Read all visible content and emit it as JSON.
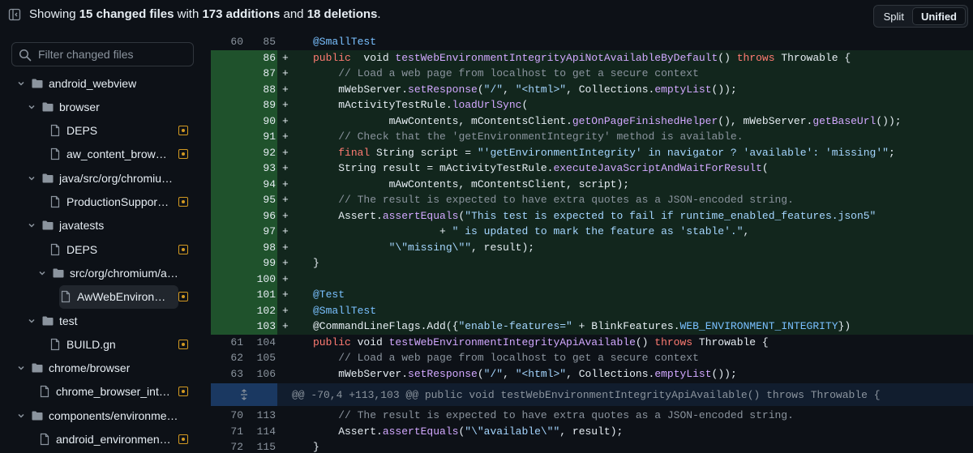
{
  "header": {
    "summary_prefix": "Showing ",
    "files_changed": "15 changed files",
    "summary_mid1": " with ",
    "additions": "173 additions",
    "summary_mid2": " and ",
    "deletions": "18 deletions",
    "summary_suffix": ".",
    "view_split": "Split",
    "view_unified": "Unified",
    "active_view": "Unified"
  },
  "sidebar": {
    "filter_placeholder": "Filter changed files",
    "items": [
      {
        "type": "folder",
        "label": "android_webview",
        "depth": 0
      },
      {
        "type": "folder",
        "label": "browser",
        "depth": 1
      },
      {
        "type": "file",
        "label": "DEPS",
        "depth": 2,
        "status": "modified"
      },
      {
        "type": "file",
        "label": "aw_content_browser…",
        "depth": 2,
        "status": "modified"
      },
      {
        "type": "folder",
        "label": "java/src/org/chromium/an…",
        "depth": 1
      },
      {
        "type": "file",
        "label": "ProductionSupporte…",
        "depth": 2,
        "status": "modified"
      },
      {
        "type": "folder",
        "label": "javatests",
        "depth": 1
      },
      {
        "type": "file",
        "label": "DEPS",
        "depth": 2,
        "status": "modified"
      },
      {
        "type": "folder",
        "label": "src/org/chromium/andro…",
        "depth": 2
      },
      {
        "type": "file",
        "label": "AwWebEnvironmen…",
        "depth": 3,
        "status": "modified",
        "selected": true
      },
      {
        "type": "folder",
        "label": "test",
        "depth": 1
      },
      {
        "type": "file",
        "label": "BUILD.gn",
        "depth": 2,
        "status": "modified"
      },
      {
        "type": "folder",
        "label": "chrome/browser",
        "depth": 0
      },
      {
        "type": "file",
        "label": "chrome_browser_inte…",
        "depth": 1,
        "status": "modified"
      },
      {
        "type": "folder",
        "label": "components/environment…",
        "depth": 0
      },
      {
        "type": "file",
        "label": "android_environment…",
        "depth": 1,
        "status": "modified"
      }
    ]
  },
  "diff": {
    "hunk_header": "@@ -70,4 +113,103 @@ public void testWebEnvironmentIntegrityApiAvailable() throws Throwable {",
    "lines": [
      {
        "kind": "ctx",
        "old": "60",
        "new": "85",
        "tokens": [
          [
            "a",
            "@SmallTest"
          ]
        ]
      },
      {
        "kind": "add",
        "old": "",
        "new": "86",
        "tokens": [
          [
            "k",
            "public"
          ],
          [
            "",
            "  void "
          ],
          [
            "f",
            "testWebEnvironmentIntegrityApiNotAvailableByDefault"
          ],
          [
            "",
            "() "
          ],
          [
            "k",
            "throws"
          ],
          [
            "",
            " Throwable {"
          ]
        ]
      },
      {
        "kind": "add",
        "old": "",
        "new": "87",
        "tokens": [
          [
            "",
            "    "
          ],
          [
            "c",
            "// Load a web page from localhost to get a secure context"
          ]
        ]
      },
      {
        "kind": "add",
        "old": "",
        "new": "88",
        "tokens": [
          [
            "",
            "    mWebServer."
          ],
          [
            "f",
            "setResponse"
          ],
          [
            "",
            "("
          ],
          [
            "s",
            "\"/\""
          ],
          [
            "",
            ", "
          ],
          [
            "s",
            "\"<html>\""
          ],
          [
            "",
            ", Collections."
          ],
          [
            "f",
            "emptyList"
          ],
          [
            "",
            "());"
          ]
        ]
      },
      {
        "kind": "add",
        "old": "",
        "new": "89",
        "tokens": [
          [
            "",
            "    mActivityTestRule."
          ],
          [
            "f",
            "loadUrlSync"
          ],
          [
            "",
            "("
          ]
        ]
      },
      {
        "kind": "add",
        "old": "",
        "new": "90",
        "tokens": [
          [
            "",
            "            mAwContents, mContentsClient."
          ],
          [
            "f",
            "getOnPageFinishedHelper"
          ],
          [
            "",
            "(), mWebServer."
          ],
          [
            "f",
            "getBaseUrl"
          ],
          [
            "",
            "());"
          ]
        ]
      },
      {
        "kind": "add",
        "old": "",
        "new": "91",
        "tokens": [
          [
            "",
            "    "
          ],
          [
            "c",
            "// Check that the 'getEnvironmentIntegrity' method is available."
          ]
        ]
      },
      {
        "kind": "add",
        "old": "",
        "new": "92",
        "tokens": [
          [
            "",
            "    "
          ],
          [
            "k",
            "final"
          ],
          [
            "",
            " String script = "
          ],
          [
            "s",
            "\"'getEnvironmentIntegrity' in navigator ? 'available': 'missing'\""
          ],
          [
            "",
            ";"
          ]
        ]
      },
      {
        "kind": "add",
        "old": "",
        "new": "93",
        "tokens": [
          [
            "",
            "    String result = mActivityTestRule."
          ],
          [
            "f",
            "executeJavaScriptAndWaitForResult"
          ],
          [
            "",
            "("
          ]
        ]
      },
      {
        "kind": "add",
        "old": "",
        "new": "94",
        "tokens": [
          [
            "",
            "            mAwContents, mContentsClient, script);"
          ]
        ]
      },
      {
        "kind": "add",
        "old": "",
        "new": "95",
        "tokens": [
          [
            "",
            "    "
          ],
          [
            "c",
            "// The result is expected to have extra quotes as a JSON-encoded string."
          ]
        ]
      },
      {
        "kind": "add",
        "old": "",
        "new": "96",
        "tokens": [
          [
            "",
            "    Assert."
          ],
          [
            "f",
            "assertEquals"
          ],
          [
            "",
            "("
          ],
          [
            "s",
            "\"This test is expected to fail if runtime_enabled_features.json5\""
          ]
        ]
      },
      {
        "kind": "add",
        "old": "",
        "new": "97",
        "tokens": [
          [
            "",
            "                    + "
          ],
          [
            "s",
            "\" is updated to mark the feature as 'stable'.\""
          ],
          [
            "",
            ","
          ]
        ]
      },
      {
        "kind": "add",
        "old": "",
        "new": "98",
        "tokens": [
          [
            "",
            "            "
          ],
          [
            "s",
            "\"\\\"missing\\\"\""
          ],
          [
            "",
            ", result);"
          ]
        ]
      },
      {
        "kind": "add",
        "old": "",
        "new": "99",
        "tokens": [
          [
            "",
            "}"
          ]
        ]
      },
      {
        "kind": "add",
        "old": "",
        "new": "100",
        "tokens": [
          [
            "",
            ""
          ]
        ]
      },
      {
        "kind": "add",
        "old": "",
        "new": "101",
        "tokens": [
          [
            "a",
            "@Test"
          ]
        ]
      },
      {
        "kind": "add",
        "old": "",
        "new": "102",
        "tokens": [
          [
            "a",
            "@SmallTest"
          ]
        ]
      },
      {
        "kind": "add",
        "old": "",
        "new": "103",
        "tokens": [
          [
            "",
            "@CommandLineFlags.Add({"
          ],
          [
            "s",
            "\"enable-features=\""
          ],
          [
            "",
            " + BlinkFeatures."
          ],
          [
            "a",
            "WEB_ENVIRONMENT_INTEGRITY"
          ],
          [
            "",
            "})"
          ]
        ]
      },
      {
        "kind": "ctx",
        "old": "61",
        "new": "104",
        "tokens": [
          [
            "k",
            "public"
          ],
          [
            "",
            " void "
          ],
          [
            "f",
            "testWebEnvironmentIntegrityApiAvailable"
          ],
          [
            "",
            "() "
          ],
          [
            "k",
            "throws"
          ],
          [
            "",
            " Throwable {"
          ]
        ]
      },
      {
        "kind": "ctx",
        "old": "62",
        "new": "105",
        "tokens": [
          [
            "",
            "    "
          ],
          [
            "c",
            "// Load a web page from localhost to get a secure context"
          ]
        ]
      },
      {
        "kind": "ctx",
        "old": "63",
        "new": "106",
        "tokens": [
          [
            "",
            "    mWebServer."
          ],
          [
            "f",
            "setResponse"
          ],
          [
            "",
            "("
          ],
          [
            "s",
            "\"/\""
          ],
          [
            "",
            ", "
          ],
          [
            "s",
            "\"<html>\""
          ],
          [
            "",
            ", Collections."
          ],
          [
            "f",
            "emptyList"
          ],
          [
            "",
            "());"
          ]
        ]
      },
      {
        "kind": "hunk"
      },
      {
        "kind": "ctx",
        "old": "70",
        "new": "113",
        "tokens": [
          [
            "",
            "    "
          ],
          [
            "c",
            "// The result is expected to have extra quotes as a JSON-encoded string."
          ]
        ]
      },
      {
        "kind": "ctx",
        "old": "71",
        "new": "114",
        "tokens": [
          [
            "",
            "    Assert."
          ],
          [
            "f",
            "assertEquals"
          ],
          [
            "",
            "("
          ],
          [
            "s",
            "\"\\\"available\\\"\""
          ],
          [
            "",
            ", result);"
          ]
        ]
      },
      {
        "kind": "ctx",
        "old": "72",
        "new": "115",
        "tokens": [
          [
            "",
            "}"
          ]
        ]
      }
    ]
  },
  "colors": {
    "background": "#0d1117",
    "add_line": "#2ea043",
    "hunk": "#388bfd",
    "modified_badge": "#d29922"
  },
  "icons": {
    "sidebar_toggle": "sidebar-collapse-icon",
    "search": "search-icon",
    "folder": "folder-icon",
    "file": "file-icon",
    "chevron": "chevron-down-icon",
    "modified": "file-diff-modified-icon",
    "expand": "unfold-icon"
  }
}
